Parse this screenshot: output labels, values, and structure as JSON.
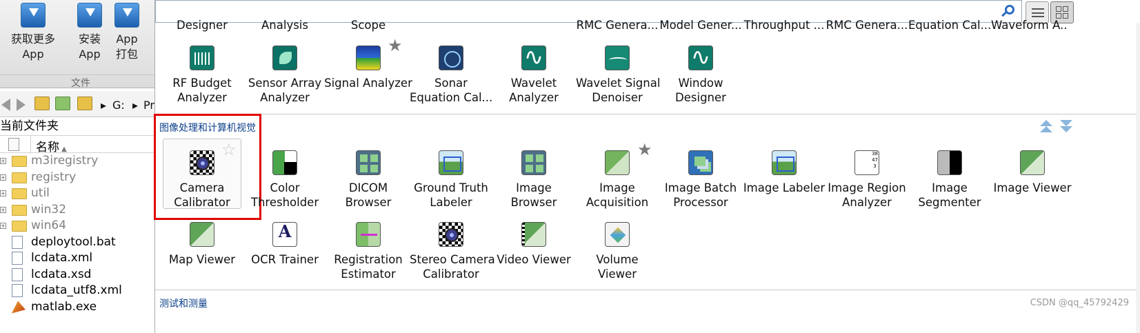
{
  "toolstrip": {
    "buttons": [
      {
        "label": "获取更多 App"
      },
      {
        "label_line1": "安装",
        "label_line2": "App"
      },
      {
        "label_line1": "App",
        "label_line2": "打包"
      }
    ],
    "section_label": "文件"
  },
  "path_bar": {
    "path": "G:",
    "path_next": "Pr"
  },
  "current_folder": {
    "title": "当前文件夹",
    "column_name": "名称",
    "items": [
      {
        "name": "m3iregistry",
        "type": "folder"
      },
      {
        "name": "registry",
        "type": "folder"
      },
      {
        "name": "util",
        "type": "folder"
      },
      {
        "name": "win32",
        "type": "folder"
      },
      {
        "name": "win64",
        "type": "folder"
      },
      {
        "name": "deploytool.bat",
        "type": "file"
      },
      {
        "name": "lcdata.xml",
        "type": "file"
      },
      {
        "name": "lcdata.xsd",
        "type": "file"
      },
      {
        "name": "lcdata_utf8.xml",
        "type": "file"
      },
      {
        "name": "matlab.exe",
        "type": "file"
      }
    ]
  },
  "gallery": {
    "top_cut_labels": [
      "Designer",
      "Analysis",
      "Scope",
      "RMC Genera...",
      "Model Gener...",
      "Throughput ...",
      "RMC Genera...",
      "Equation Cal...",
      "Waveform A..."
    ],
    "row1": [
      {
        "line1": "RF Budget",
        "line2": "Analyzer"
      },
      {
        "line1": "Sensor Array",
        "line2": "Analyzer"
      },
      {
        "line1": "Signal Analyzer",
        "line2": ""
      },
      {
        "line1": "Sonar",
        "line2": "Equation Cal..."
      },
      {
        "line1": "Wavelet",
        "line2": "Analyzer"
      },
      {
        "line1": "Wavelet Signal",
        "line2": "Denoiser"
      },
      {
        "line1": "Window",
        "line2": "Designer"
      }
    ],
    "section_image": "图像处理和计算机视觉",
    "row2": [
      {
        "line1": "Camera",
        "line2": "Calibrator"
      },
      {
        "line1": "Color",
        "line2": "Thresholder"
      },
      {
        "line1": "DICOM",
        "line2": "Browser"
      },
      {
        "line1": "Ground Truth",
        "line2": "Labeler"
      },
      {
        "line1": "Image",
        "line2": "Browser"
      },
      {
        "line1": "Image",
        "line2": "Acquisition"
      },
      {
        "line1": "Image Batch",
        "line2": "Processor"
      },
      {
        "line1": "Image Labeler",
        "line2": ""
      },
      {
        "line1": "Image Region",
        "line2": "Analyzer"
      },
      {
        "line1": "Image",
        "line2": "Segmenter"
      },
      {
        "line1": "Image Viewer",
        "line2": ""
      }
    ],
    "row3": [
      {
        "line1": "Map Viewer",
        "line2": ""
      },
      {
        "line1": "OCR Trainer",
        "line2": ""
      },
      {
        "line1": "Registration",
        "line2": "Estimator"
      },
      {
        "line1": "Stereo Camera",
        "line2": "Calibrator"
      },
      {
        "line1": "Video Viewer",
        "line2": ""
      },
      {
        "line1": "Volume",
        "line2": "Viewer"
      }
    ],
    "section_test": "测试和测量"
  },
  "watermark": "CSDN @qq_45792429",
  "colors": {
    "highlight": "#e00000",
    "section_title": "#0b3f8a",
    "accent": "#2b6bc2"
  }
}
